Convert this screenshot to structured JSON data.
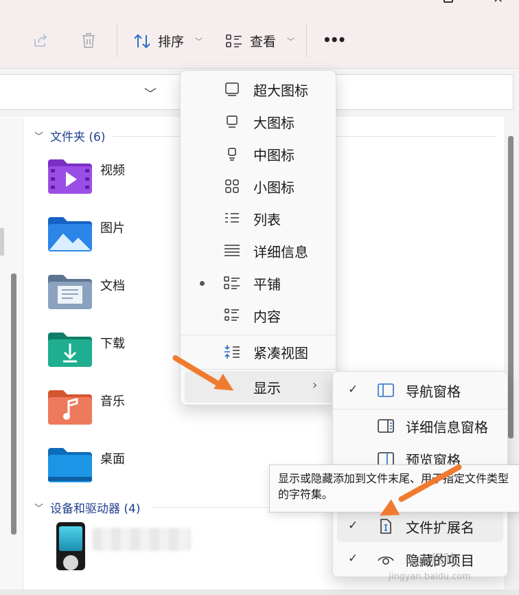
{
  "toolbar": {
    "sort_label": "排序",
    "view_label": "查看",
    "more_label": "•••",
    "icons": [
      "share-icon",
      "delete-icon",
      "sort-icon",
      "view-icon"
    ]
  },
  "sections": {
    "folders_header": "文件夹 (6)",
    "devices_header": "设备和驱动器 (4)"
  },
  "folders": [
    {
      "label": "视频",
      "icon": "videos-folder-icon",
      "color": "#8b3fd6"
    },
    {
      "label": "图片",
      "icon": "pictures-folder-icon",
      "color": "#1e74d8"
    },
    {
      "label": "文档",
      "icon": "documents-folder-icon",
      "color": "#6f8aa6"
    },
    {
      "label": "下载",
      "icon": "downloads-folder-icon",
      "color": "#1c9c83"
    },
    {
      "label": "音乐",
      "icon": "music-folder-icon",
      "color": "#e8704a"
    },
    {
      "label": "桌面",
      "icon": "desktop-folder-icon",
      "color": "#1a86d1"
    }
  ],
  "view_menu": {
    "items": [
      {
        "label": "超大图标",
        "icon": "extra-large-icons-icon"
      },
      {
        "label": "大图标",
        "icon": "large-icons-icon"
      },
      {
        "label": "中图标",
        "icon": "medium-icons-icon"
      },
      {
        "label": "小图标",
        "icon": "small-icons-icon"
      },
      {
        "label": "列表",
        "icon": "list-icon"
      },
      {
        "label": "详细信息",
        "icon": "details-icon"
      },
      {
        "label": "平铺",
        "icon": "tiles-icon",
        "selected": true
      },
      {
        "label": "内容",
        "icon": "content-icon"
      }
    ],
    "compact_label": "紧凑视图",
    "show_label": "显示"
  },
  "show_submenu": {
    "items": [
      {
        "label": "导航窗格",
        "checked": true,
        "icon": "navigation-pane-icon"
      },
      {
        "label": "详细信息窗格",
        "checked": false,
        "icon": "details-pane-icon"
      },
      {
        "label": "预览窗格",
        "checked": false,
        "icon": "preview-pane-icon"
      },
      {
        "label": "文件扩展名",
        "checked": true,
        "icon": "file-extension-icon"
      },
      {
        "label": "隐藏的项目",
        "checked": true,
        "icon": "hidden-items-icon"
      }
    ],
    "check_mark": "✓"
  },
  "tooltip": {
    "text": "显示或隐藏添加到文件末尾、用于指定文件类型的字符集。"
  },
  "colors": {
    "accent_arrow": "#f07b30",
    "section_header": "#1f3f8c",
    "pane_icon": "#2a6fc9"
  }
}
